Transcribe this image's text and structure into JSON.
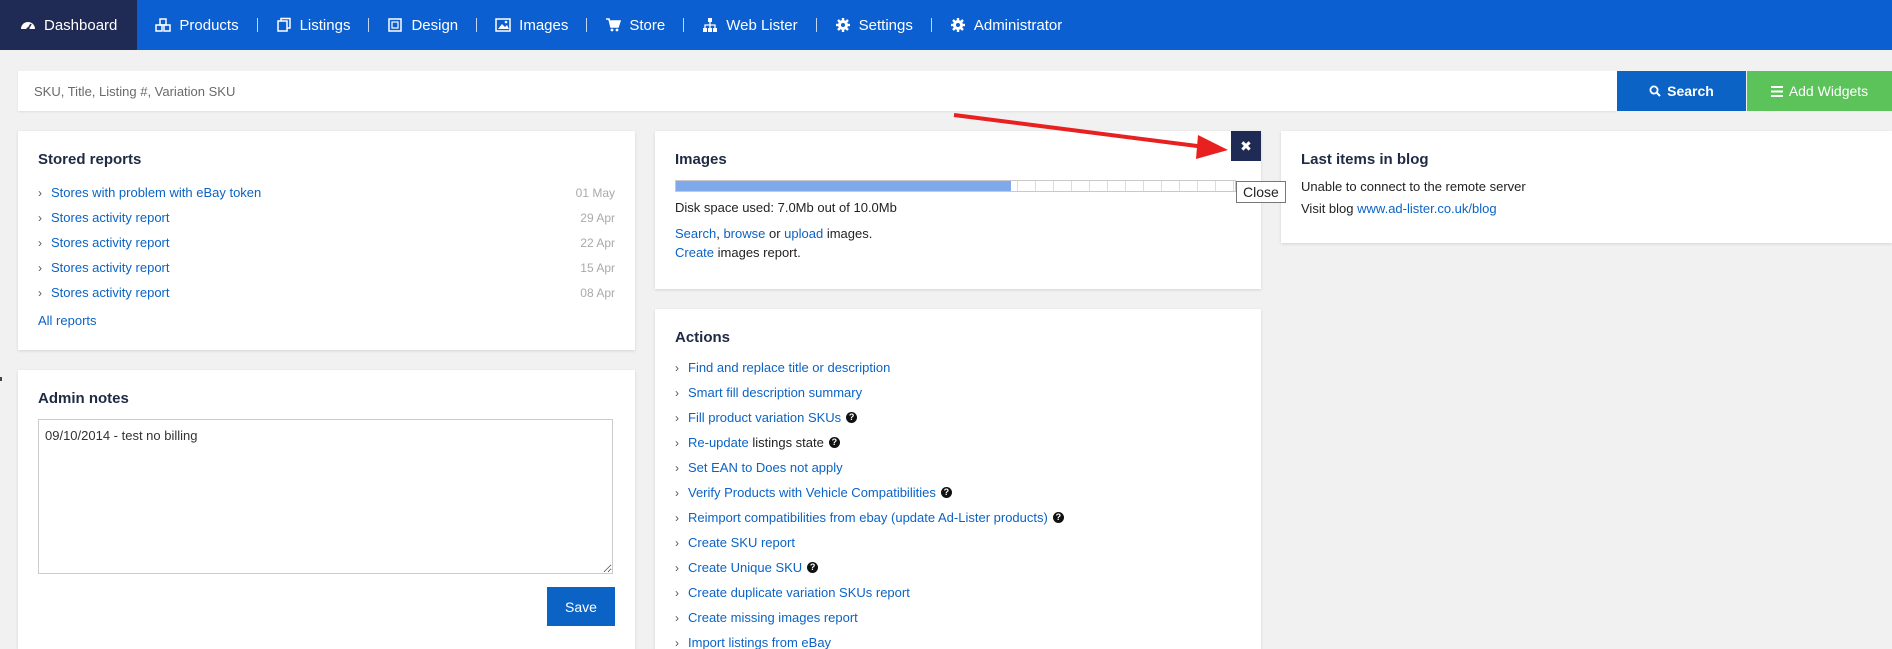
{
  "nav": {
    "items": [
      {
        "label": "Dashboard",
        "icon": "dashboard-icon"
      },
      {
        "label": "Products",
        "icon": "cubes-icon"
      },
      {
        "label": "Listings",
        "icon": "copy-icon"
      },
      {
        "label": "Design",
        "icon": "crop-icon"
      },
      {
        "label": "Images",
        "icon": "image-icon"
      },
      {
        "label": "Store",
        "icon": "cart-icon"
      },
      {
        "label": "Web Lister",
        "icon": "sitemap-icon"
      },
      {
        "label": "Settings",
        "icon": "gear-icon"
      },
      {
        "label": "Administrator",
        "icon": "gear-icon"
      }
    ]
  },
  "search": {
    "placeholder": "SKU, Title, Listing #, Variation SKU",
    "value": "",
    "search_label": "Search",
    "add_widgets_label": "Add Widgets"
  },
  "stored_reports": {
    "title": "Stored reports",
    "items": [
      {
        "label": "Stores with problem with eBay token",
        "date": "01 May"
      },
      {
        "label": "Stores activity report",
        "date": "29 Apr"
      },
      {
        "label": "Stores activity report",
        "date": "22 Apr"
      },
      {
        "label": "Stores activity report",
        "date": "15 Apr"
      },
      {
        "label": "Stores activity report",
        "date": "08 Apr"
      }
    ],
    "all_reports_label": "All reports"
  },
  "admin_notes": {
    "title": "Admin notes",
    "value": "09/10/2014 - test no billing",
    "save_label": "Save"
  },
  "images": {
    "title": "Images",
    "usage_fraction": 0.6,
    "disk_label": "Disk space used: 7.0Mb out of 10.0Mb",
    "search_link": "Search",
    "sep1": ", ",
    "browse_link": "browse",
    "or_text": " or ",
    "upload_link": "upload",
    "images_text": " images.",
    "create_link": "Create",
    "report_text": " images report.",
    "close_tooltip": "Close"
  },
  "actions": {
    "title": "Actions",
    "items": [
      {
        "link": "Find and replace title or description",
        "tail": "",
        "help": false
      },
      {
        "link": "Smart fill description summary",
        "tail": "",
        "help": false
      },
      {
        "link": "Fill product variation SKUs",
        "tail": "",
        "help": true
      },
      {
        "link": "Re-update",
        "tail": " listings state",
        "help": true
      },
      {
        "link": "Set EAN to Does not apply",
        "tail": "",
        "help": false
      },
      {
        "link": "Verify Products with Vehicle Compatibilities",
        "tail": "",
        "help": true
      },
      {
        "link": "Reimport compatibilities from ebay (update Ad-Lister products)",
        "tail": "",
        "help": true
      },
      {
        "link": "Create SKU report",
        "tail": "",
        "help": false
      },
      {
        "link": "Create Unique SKU",
        "tail": "",
        "help": true
      },
      {
        "link": "Create duplicate variation SKUs report",
        "tail": "",
        "help": false
      },
      {
        "link": "Create missing images report",
        "tail": "",
        "help": false
      },
      {
        "link": "Import listings from eBay",
        "tail": "",
        "help": false
      }
    ]
  },
  "blog": {
    "title": "Last items in blog",
    "error": "Unable to connect to the remote server",
    "visit_text": "Visit blog ",
    "link": "www.ad-lister.co.uk/blog"
  },
  "colors": {
    "nav_bg": "#0b5fd0",
    "nav_active": "#1f2a55",
    "primary": "#0b63c6",
    "success": "#5cc25a",
    "annotation_arrow": "#e8201f"
  }
}
